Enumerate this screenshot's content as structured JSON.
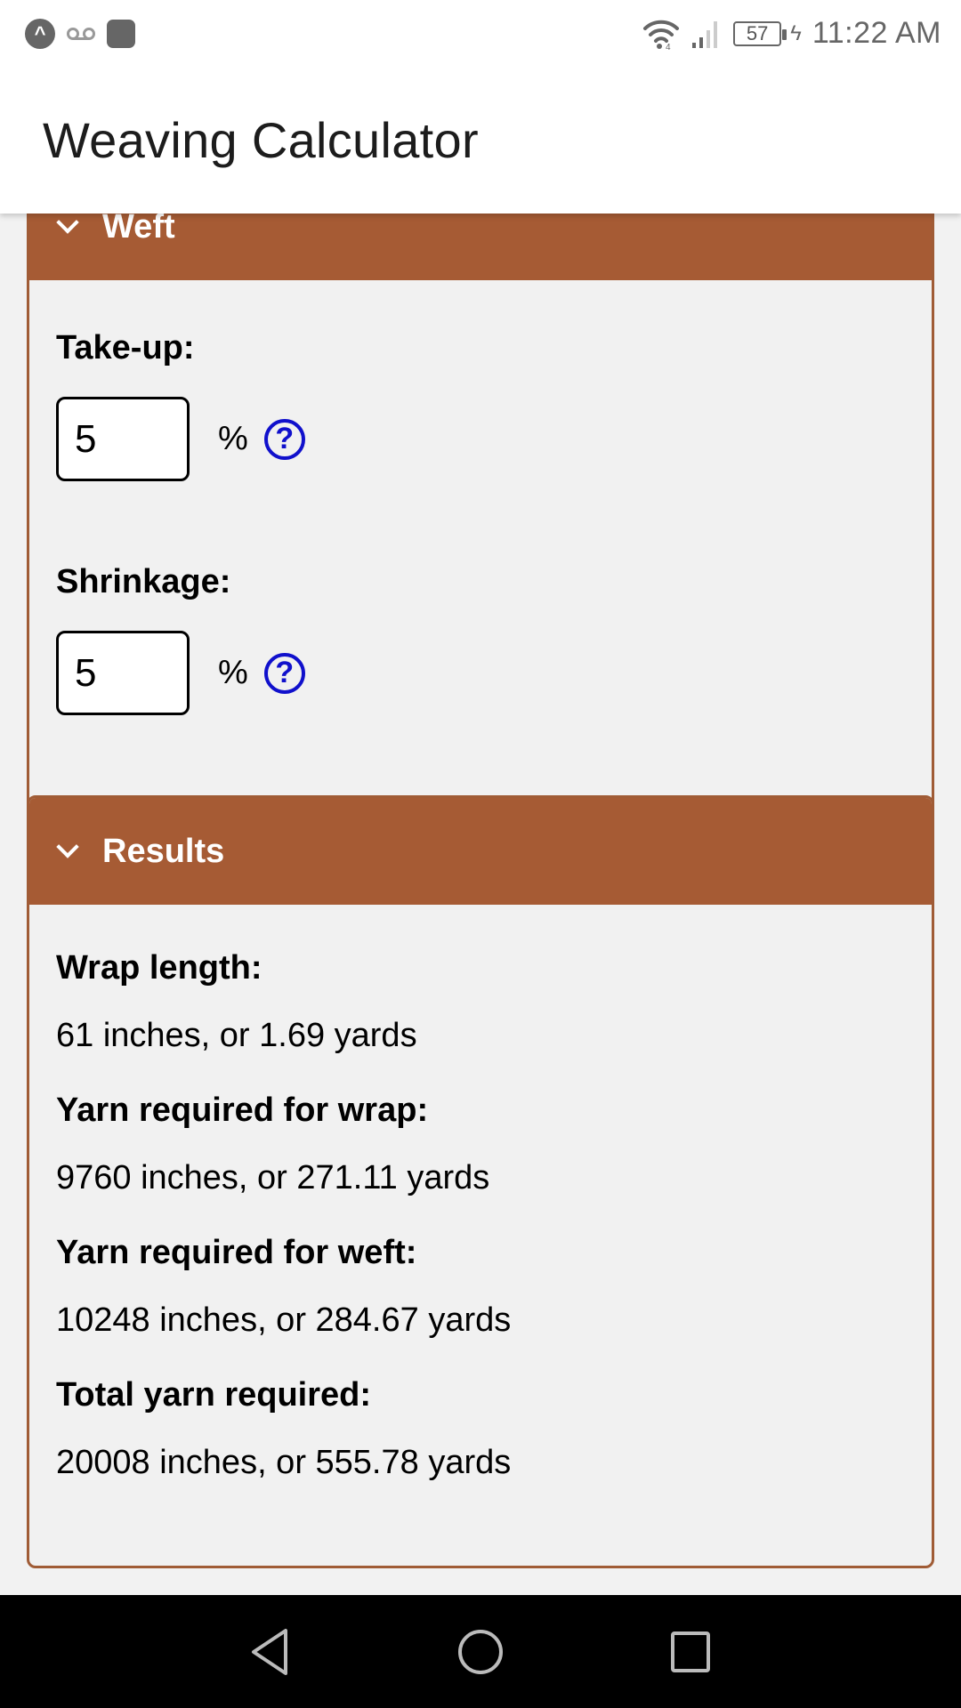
{
  "status_bar": {
    "left_icons": [
      "app-notification-icon",
      "voicemail-icon",
      "square-notification-icon"
    ],
    "right_icons": [
      "wifi-icon",
      "cellular-signal-icon",
      "battery-icon",
      "charging-icon"
    ],
    "battery_level": "57",
    "time": "11:22 AM"
  },
  "app_bar": {
    "title": "Weaving Calculator"
  },
  "weft_section": {
    "title": "Weft",
    "expanded": true,
    "fields": [
      {
        "label": "Take-up:",
        "value": "5",
        "unit": "%",
        "help_symbol": "?"
      },
      {
        "label": "Shrinkage:",
        "value": "5",
        "unit": "%",
        "help_symbol": "?"
      }
    ]
  },
  "results_section": {
    "title": "Results",
    "expanded": true,
    "items": [
      {
        "label": "Wrap length:",
        "value": "61 inches, or 1.69 yards"
      },
      {
        "label": "Yarn required for wrap:",
        "value": "9760 inches, or 271.11 yards"
      },
      {
        "label": "Yarn required for weft:",
        "value": "10248 inches, or 284.67 yards"
      },
      {
        "label": "Total yarn required:",
        "value": "20008 inches, or 555.78 yards"
      }
    ]
  },
  "nav_bar": {
    "buttons": [
      "back",
      "home",
      "recents"
    ]
  },
  "colors": {
    "section_header": "#a65b34",
    "section_border": "#a05c36",
    "help_icon": "#1010cc",
    "background": "#f2f2f2"
  }
}
